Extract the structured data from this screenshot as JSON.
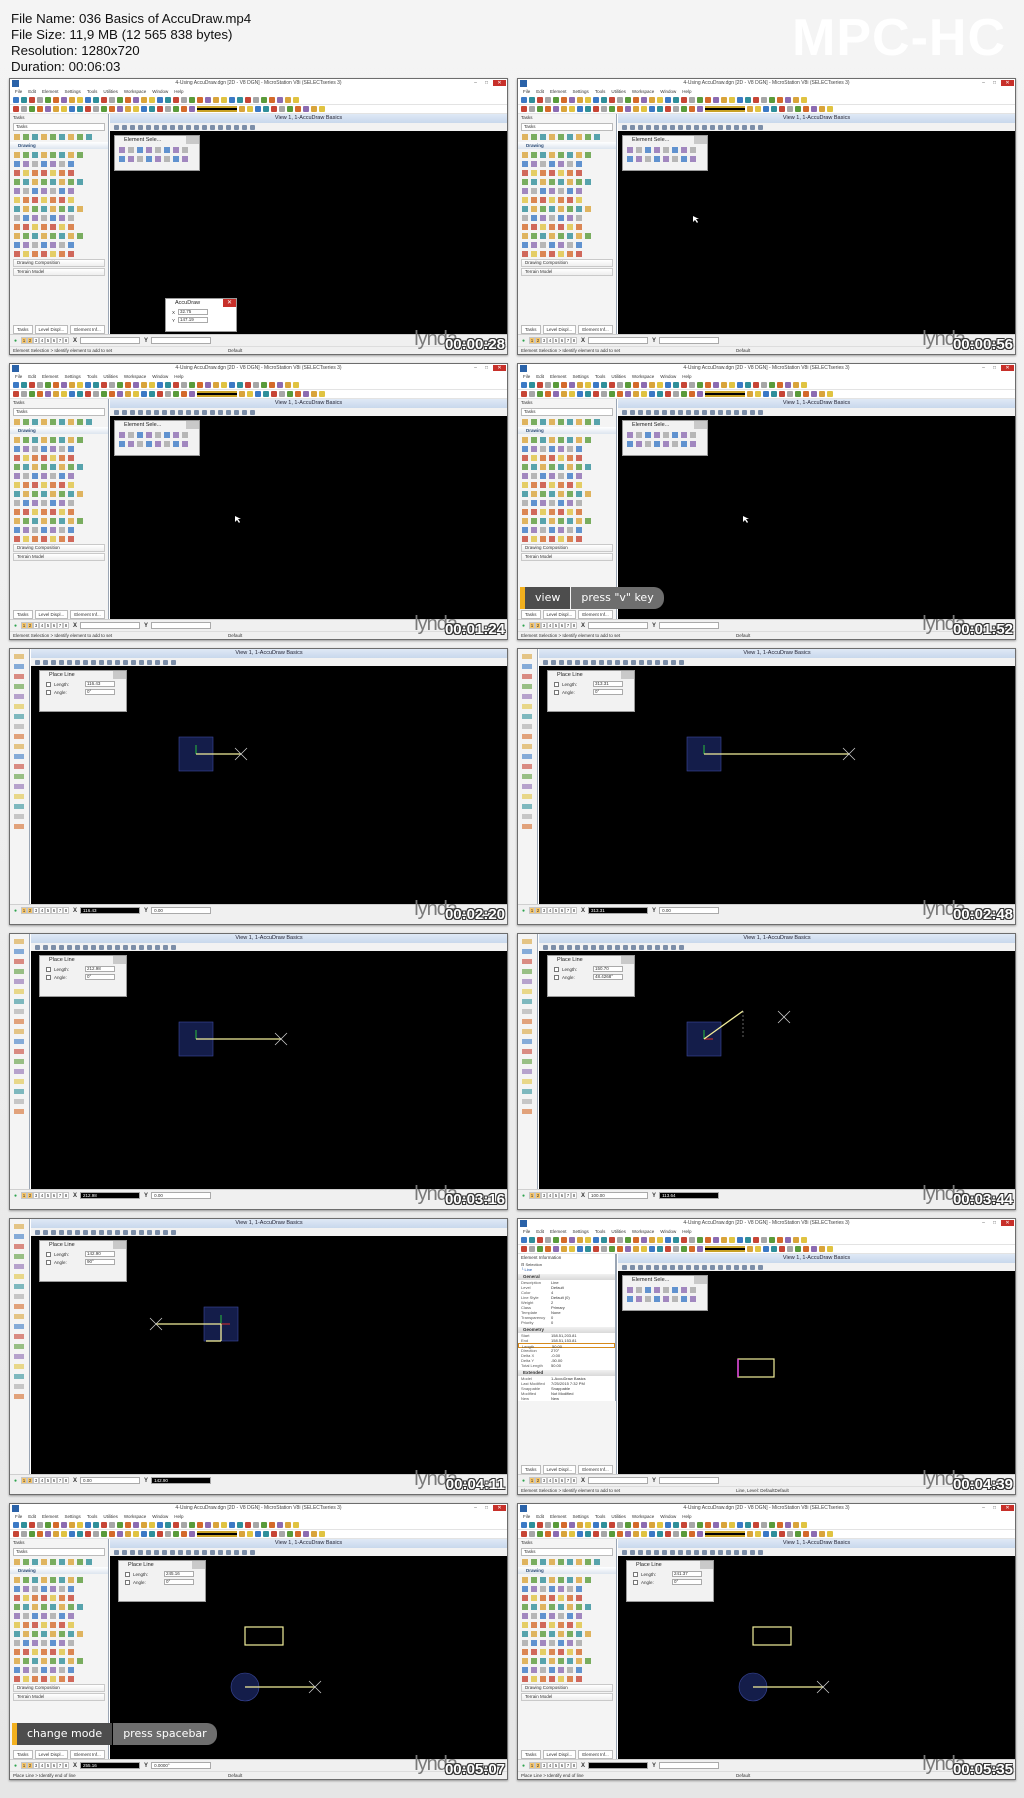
{
  "file_info": {
    "name_line": "File Name: 036 Basics of AccuDraw.mp4",
    "size_line": "File Size: 11,9 MB (12 565 838 bytes)",
    "resolution_line": "Resolution: 1280x720",
    "duration_line": "Duration: 00:06:03"
  },
  "brand": "MPC-HC",
  "app": {
    "window_title": "4-Using AccuDraw.dgn [2D - V8 DGN] - MicroStation V8i (SELECTseries 3)",
    "menu": [
      "File",
      "Edit",
      "Element",
      "Settings",
      "Tools",
      "Utilities",
      "Workspace",
      "Window",
      "Help"
    ],
    "level_dropdown": "Default",
    "view_title": "View 1, 1-AccuDraw Basics",
    "tasks_header": "Tasks",
    "tasks_dropdown": "Tasks",
    "drawing_section": "Drawing",
    "panel_drawing_composition": "Drawing Composition",
    "panel_terrain_model": "Terrain Model",
    "bottom_tabs": [
      "Tasks",
      "Level Displ...",
      "Element Inf..."
    ],
    "view_numbers": [
      "1",
      "2",
      "3",
      "4",
      "5",
      "6",
      "7",
      "8"
    ],
    "status_default": "Element Selection > Identify element to add to set",
    "status_place_line": "Place Line > Identify end of line",
    "status_right": "Default",
    "watermark": "lynda"
  },
  "dialogs": {
    "element_selection_title": "Element Sele...",
    "accudraw_title": "AccuDraw",
    "place_line_title": "Place Line",
    "length_label": "Length:",
    "angle_label": "Angle:"
  },
  "captions": {
    "view": {
      "action": "view",
      "key": "press \"v\" key"
    },
    "mode": {
      "action": "change mode",
      "key": "press spacebar"
    }
  },
  "element_info": {
    "header": "Element Information",
    "tree_root": "Selection",
    "tree_item": "Line",
    "general": "General",
    "general_rows": [
      [
        "Description",
        "Line"
      ],
      [
        "Level",
        "Default"
      ],
      [
        "Color",
        "4"
      ],
      [
        "Line Style",
        "Default (0)"
      ],
      [
        "Weight",
        "2"
      ],
      [
        "Class",
        "Primary"
      ],
      [
        "Template",
        "None"
      ],
      [
        "Transparency",
        "0"
      ],
      [
        "Priority",
        "0"
      ]
    ],
    "geometry": "Geometry",
    "geometry_rows": [
      [
        "Start",
        "158.51,203.81"
      ],
      [
        "End",
        "158.51,153.81"
      ],
      [
        "Length",
        "50.00"
      ],
      [
        "Direction",
        "270°"
      ],
      [
        "Delta X",
        "-0.00"
      ],
      [
        "Delta Y",
        "-50.00"
      ],
      [
        "Total Length",
        "50.00"
      ]
    ],
    "extended": "Extended",
    "extended_rows": [
      [
        "Model",
        "1-AccuDraw Basics"
      ],
      [
        "Last Modified",
        "7/25/2015 7:32 PM"
      ],
      [
        "Snappable",
        "Snappable"
      ],
      [
        "Modified",
        "Not Modified"
      ],
      [
        "New",
        "New"
      ]
    ]
  },
  "frames": [
    {
      "timestamp": "00:00:28",
      "layout": "full",
      "x": "",
      "y": "",
      "accudraw": {
        "x": "32.75",
        "y": "147.19"
      }
    },
    {
      "timestamp": "00:00:56",
      "layout": "full",
      "x": "",
      "y": ""
    },
    {
      "timestamp": "00:01:24",
      "layout": "full",
      "x": "",
      "y": ""
    },
    {
      "timestamp": "00:01:52",
      "layout": "full",
      "x": "",
      "y": "",
      "caption": "view"
    },
    {
      "timestamp": "00:02:20",
      "layout": "zoomed",
      "x": "116.43",
      "y": "0.00",
      "active": "x",
      "length": "116.43",
      "angle": "0°"
    },
    {
      "timestamp": "00:02:48",
      "layout": "zoomed",
      "x": "313.31",
      "y": "0.00",
      "active": "x",
      "length": "313.31",
      "angle": "0°"
    },
    {
      "timestamp": "00:03:16",
      "layout": "zoomed",
      "x": "212.98",
      "y": "0.00",
      "active": "x",
      "length": "212.98",
      "angle": "0°"
    },
    {
      "timestamp": "00:03:44",
      "layout": "zoomed",
      "x": "100.00",
      "y": "113.64",
      "active": "y",
      "length": "150.70",
      "angle": "48.4268°"
    },
    {
      "timestamp": "00:04:11",
      "layout": "zoomed",
      "x": "0.00",
      "y": "142.90",
      "active": "y",
      "length": "142.90",
      "angle": "90°"
    },
    {
      "timestamp": "00:04:39",
      "layout": "props",
      "x": "",
      "y": "",
      "status_mid": "Line, Level: Default"
    },
    {
      "timestamp": "00:05:07",
      "layout": "full",
      "x": "255.16",
      "y": "0.0000°",
      "active": "x",
      "length": "245.16",
      "angle": "0°",
      "caption": "mode"
    },
    {
      "timestamp": "00:05:35",
      "layout": "full",
      "x": "",
      "y": "",
      "active": "x",
      "length": "241.37",
      "angle": "0°"
    }
  ]
}
